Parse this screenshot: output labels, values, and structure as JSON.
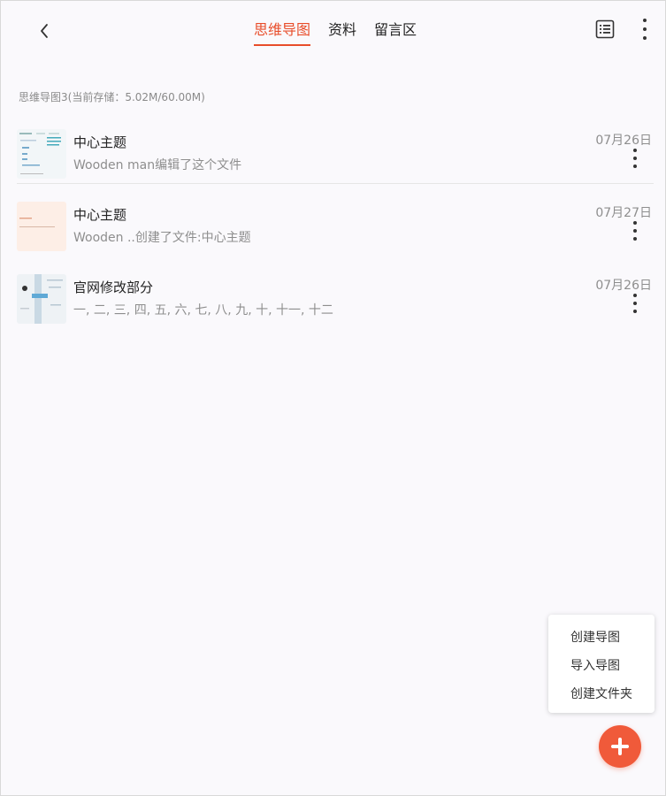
{
  "header": {
    "back_icon": "chevron-left-icon",
    "tabs": [
      {
        "label": "思维导图",
        "active": true
      },
      {
        "label": "资料",
        "active": false
      },
      {
        "label": "留言区",
        "active": false
      }
    ],
    "list_icon": "list-view-icon",
    "more_icon": "more-vertical-icon"
  },
  "storage_text": "思维导图3(当前存储：5.02M/60.00M)",
  "files": [
    {
      "title": "中心主题",
      "desc": "Wooden man编辑了这个文件",
      "date": "07月26日"
    },
    {
      "title": "中心主题",
      "desc": "Wooden ..创建了文件:中心主题",
      "date": "07月27日"
    },
    {
      "title": "官网修改部分",
      "desc": "一, 二, 三, 四, 五, 六, 七, 八, 九, 十, 十一, 十二",
      "date": "07月26日"
    }
  ],
  "menu": {
    "items": [
      "创建导图",
      "导入导图",
      "创建文件夹"
    ]
  },
  "fab_icon": "plus-icon",
  "colors": {
    "accent": "#e84d2a",
    "fab": "#f05a3a",
    "background": "#faf9fc"
  }
}
